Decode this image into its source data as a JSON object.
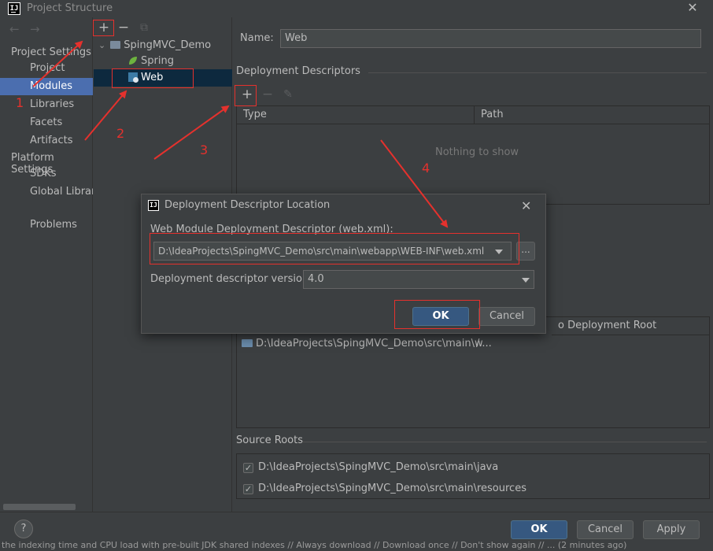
{
  "window": {
    "title": "Project Structure",
    "logo_text": "IJ",
    "close_glyph": "✕"
  },
  "nav": {
    "back_glyph": "←",
    "forward_glyph": "→",
    "project_settings_header": "Project Settings",
    "platform_settings_header": "Platform Settings",
    "items": [
      "Project",
      "Modules",
      "Libraries",
      "Facets",
      "Artifacts"
    ],
    "platform_items": [
      "SDKs",
      "Global Libraries"
    ],
    "problems": "Problems",
    "selected": "Modules"
  },
  "tree": {
    "add_glyph": "+",
    "remove_glyph": "−",
    "copy_glyph": "⧉",
    "expand_glyph": "⌄",
    "module": "SpingMVC_Demo",
    "children": [
      "Spring",
      "Web"
    ],
    "selected": "Web"
  },
  "right": {
    "name_label": "Name:",
    "name_value": "Web",
    "deployment_descriptors_title": "Deployment Descriptors",
    "add_glyph": "+",
    "remove_glyph": "−",
    "edit_glyph": "✎",
    "col_type": "Type",
    "col_path": "Path",
    "empty_text": "Nothing to show",
    "web_root_col_fragment": "o Deployment Root",
    "web_root_dir": "D:\\IdeaProjects\\SpingMVC_Demo\\src\\main\\w...",
    "web_root_path": "/",
    "source_roots_title": "Source Roots",
    "source_roots": [
      "D:\\IdeaProjects\\SpingMVC_Demo\\src\\main\\java",
      "D:\\IdeaProjects\\SpingMVC_Demo\\src\\main\\resources"
    ],
    "check_glyph": "✓"
  },
  "dialog": {
    "title": "Deployment Descriptor Location",
    "logo_text": "IJ",
    "close_glyph": "✕",
    "location_label": "Web Module Deployment Descriptor (web.xml):",
    "location_value": "D:\\IdeaProjects\\SpingMVC_Demo\\src\\main\\webapp\\WEB-INF\\web.xml",
    "browse_label": "...",
    "version_label": "Deployment descriptor version",
    "version_value": "4.0",
    "ok_label": "OK",
    "cancel_label": "Cancel"
  },
  "bottom": {
    "help_glyph": "?",
    "ok_label": "OK",
    "cancel_label": "Cancel",
    "apply_label": "Apply",
    "status_text": "the indexing time and CPU load with pre-built JDK shared indexes // Always download // Download once // Don't show again // ... (2 minutes ago)"
  },
  "annotations": {
    "numbers": [
      "1",
      "2",
      "3",
      "4"
    ]
  },
  "colors": {
    "accent": "#4b6eaf",
    "annotation": "#e5312d",
    "primary_button": "#365880"
  }
}
